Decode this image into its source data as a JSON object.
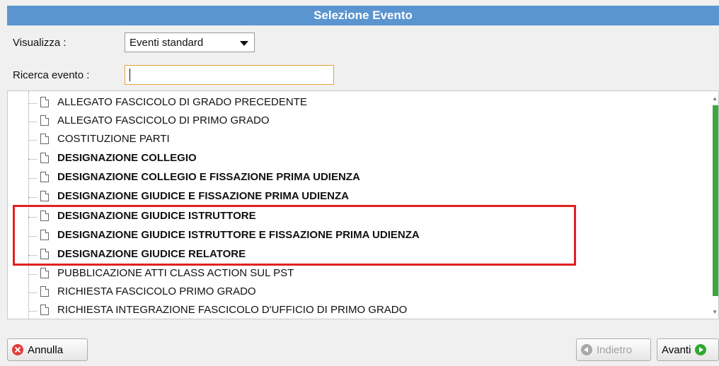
{
  "window": {
    "title": "Selezione Evento"
  },
  "filters": {
    "view_label": "Visualizza :",
    "view_value": "Eventi standard",
    "search_label": "Ricerca evento :",
    "search_value": ""
  },
  "events": [
    {
      "label": "ALLEGATO FASCICOLO DI GRADO PRECEDENTE",
      "bold": false
    },
    {
      "label": "ALLEGATO FASCICOLO DI PRIMO GRADO",
      "bold": false
    },
    {
      "label": "COSTITUZIONE PARTI",
      "bold": false
    },
    {
      "label": "DESIGNAZIONE COLLEGIO",
      "bold": true
    },
    {
      "label": "DESIGNAZIONE COLLEGIO E FISSAZIONE PRIMA UDIENZA",
      "bold": true
    },
    {
      "label": "DESIGNAZIONE GIUDICE E FISSAZIONE PRIMA UDIENZA",
      "bold": true
    },
    {
      "label": "DESIGNAZIONE GIUDICE ISTRUTTORE",
      "bold": true
    },
    {
      "label": "DESIGNAZIONE GIUDICE ISTRUTTORE E FISSAZIONE PRIMA UDIENZA",
      "bold": true
    },
    {
      "label": "DESIGNAZIONE GIUDICE RELATORE",
      "bold": true
    },
    {
      "label": "PUBBLICAZIONE ATTI CLASS ACTION SUL PST",
      "bold": false
    },
    {
      "label": "RICHIESTA FASCICOLO PRIMO GRADO",
      "bold": false
    },
    {
      "label": "RICHIESTA INTEGRAZIONE FASCICOLO D'UFFICIO DI PRIMO GRADO",
      "bold": false
    }
  ],
  "buttons": {
    "cancel": "Annulla",
    "back": "Indietro",
    "next": "Avanti"
  },
  "colors": {
    "title_bar": "#5b95cf",
    "highlight": "#e02020",
    "scrollbar": "#3fa63f"
  }
}
